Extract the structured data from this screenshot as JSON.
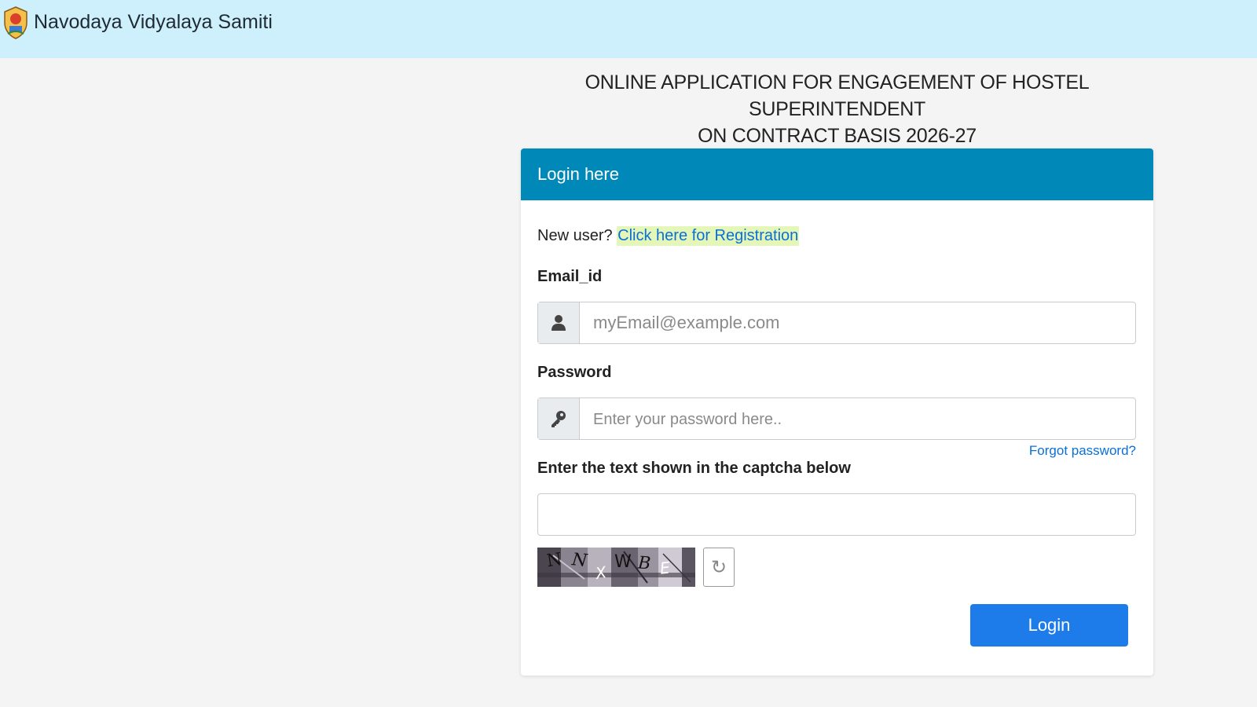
{
  "header": {
    "brand": "Navodaya Vidyalaya Samiti",
    "logo_icon": "nvs-emblem-icon",
    "background": "#cdf0fc"
  },
  "page": {
    "title_line1": "ONLINE APPLICATION FOR ENGAGEMENT OF HOSTEL SUPERINTENDENT",
    "title_line2": "ON CONTRACT BASIS 2026-27"
  },
  "login_card": {
    "header": "Login here",
    "header_color": "#0088b8",
    "new_user_text": "New user?",
    "registration_link": "Click here for Registration",
    "email": {
      "label": "Email_id",
      "placeholder": "myEmail@example.com",
      "icon": "user-icon",
      "value": ""
    },
    "password": {
      "label": "Password",
      "placeholder": "Enter your password here..",
      "icon": "key-icon",
      "value": ""
    },
    "forgot_password": "Forgot password?",
    "captcha": {
      "label": "Enter the text shown in the captcha below",
      "chars": [
        "N",
        "N",
        "X",
        "W",
        "B",
        "E"
      ],
      "refresh_icon": "refresh-icon",
      "value": ""
    },
    "login_button": "Login",
    "login_button_color": "#1e7bea"
  }
}
